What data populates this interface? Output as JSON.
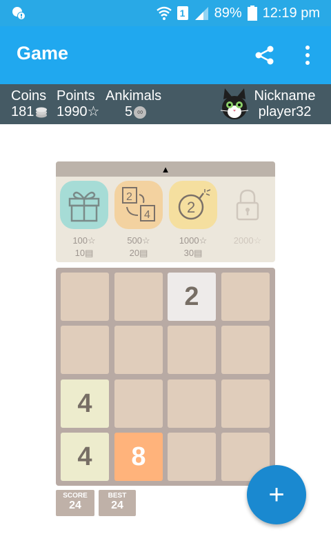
{
  "status_bar": {
    "battery": "89%",
    "time": "12:19 pm",
    "sim": "1"
  },
  "app_bar": {
    "title": "Game"
  },
  "stats": {
    "coins_label": "Coins",
    "coins_value": "181",
    "points_label": "Points",
    "points_value": "1990☆",
    "ankimals_label": "Ankimals",
    "ankimals_value": "5",
    "nickname_label": "Nickname",
    "nickname_value": "player32"
  },
  "panel": {
    "handle_glyph": "▲",
    "powerups": [
      {
        "points": "100☆",
        "coins": "10",
        "icon": "gift-icon",
        "color": "#a6dcd6"
      },
      {
        "points": "500☆",
        "coins": "20",
        "icon": "swap-tiles-icon",
        "color": "#f3d2a0"
      },
      {
        "points": "1000☆",
        "coins": "30",
        "icon": "bomb-icon",
        "color": "#f5df9f"
      },
      {
        "points": "2000☆",
        "coins": "",
        "icon": "lock-icon",
        "color": "#ece7dc"
      }
    ]
  },
  "board": {
    "rows": [
      [
        "",
        "",
        "2",
        ""
      ],
      [
        "",
        "",
        "",
        ""
      ],
      [
        "4",
        "",
        "",
        ""
      ],
      [
        "4",
        "8",
        "",
        ""
      ]
    ]
  },
  "scores": {
    "score_label": "SCORE",
    "score_value": "24",
    "best_label": "BEST",
    "best_value": "24"
  },
  "fab": {
    "glyph": "+"
  }
}
